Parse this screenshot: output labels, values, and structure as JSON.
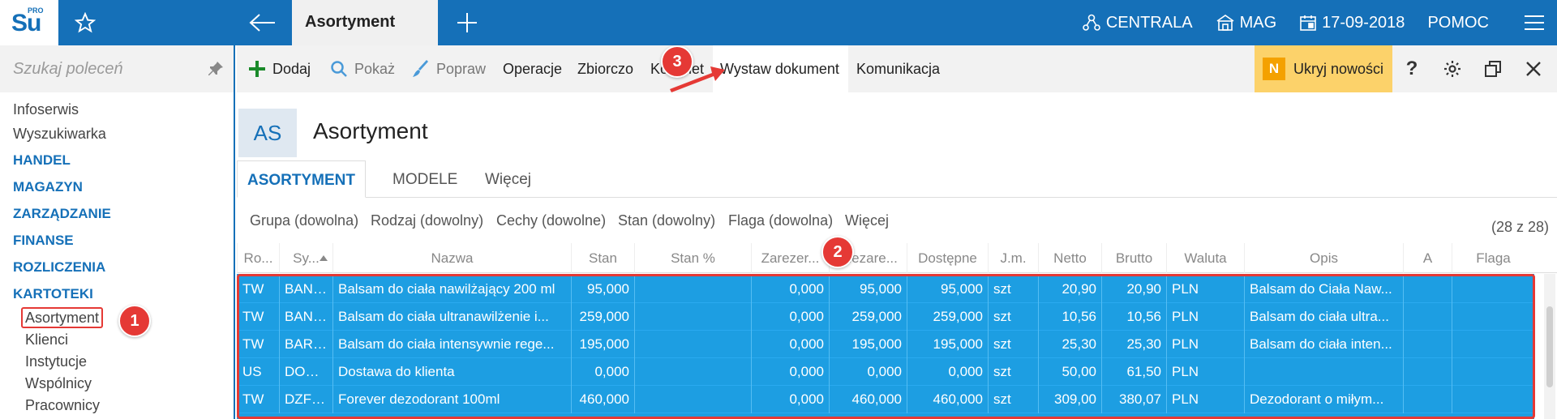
{
  "app": {
    "logo_text": "Su",
    "logo_pro": "PRO",
    "active_tab": "Asortyment"
  },
  "topbar": {
    "items": [
      "CENTRALA",
      "MAG",
      "17-09-2018",
      "POMOC"
    ]
  },
  "sidebar": {
    "search_placeholder": "Szukaj poleceń",
    "items": [
      "Infoserwis",
      "Wyszukiwarka"
    ],
    "sections": [
      "HANDEL",
      "MAGAZYN",
      "ZARZĄDZANIE",
      "FINANSE",
      "ROZLICZENIA",
      "KARTOTEKI"
    ],
    "sub_items": [
      "Asortyment",
      "Klienci",
      "Instytucje",
      "Wspólnicy",
      "Pracownicy"
    ]
  },
  "toolbar": {
    "add": "Dodaj",
    "show": "Pokaż",
    "edit": "Popraw",
    "operations": "Operacje",
    "bulk": "Zbiorczo",
    "kit": "Komplet",
    "issue_document": "Wystaw dokument",
    "communication": "Komunikacja",
    "hide_news": "Ukryj nowości",
    "news_badge": "N",
    "help": "?"
  },
  "module": {
    "badge": "AS",
    "title": "Asortyment"
  },
  "view_tabs": [
    "ASORTYMENT",
    "MODELE",
    "Więcej"
  ],
  "filters": {
    "items": [
      "Grupa (dowolna)",
      "Rodzaj (dowolny)",
      "Cechy (dowolne)",
      "Stan (dowolny)",
      "Flaga (dowolna)",
      "Więcej"
    ],
    "count": "(28 z 28)"
  },
  "grid": {
    "headers": [
      "Ro...",
      "Sy...",
      "Nazwa",
      "Stan",
      "Stan %",
      "Zarezer...",
      "Niezare...",
      "Dostępne",
      "J.m.",
      "Netto",
      "Brutto",
      "Waluta",
      "Opis",
      "A",
      "Flaga"
    ],
    "rows": [
      [
        "TW",
        "BANA...",
        "Balsam do ciała nawilżający 200 ml",
        "95,000",
        "",
        "0,000",
        "95,000",
        "95,000",
        "szt",
        "20,90",
        "20,90",
        "PLN",
        "Balsam do Ciała Naw...",
        "",
        ""
      ],
      [
        "TW",
        "BANA...",
        "Balsam do ciała ultranawilżenie i...",
        "259,000",
        "",
        "0,000",
        "259,000",
        "259,000",
        "szt",
        "10,56",
        "10,56",
        "PLN",
        "Balsam do ciała ultra...",
        "",
        ""
      ],
      [
        "TW",
        "BARE...",
        "Balsam do ciała intensywnie rege...",
        "195,000",
        "",
        "0,000",
        "195,000",
        "195,000",
        "szt",
        "25,30",
        "25,30",
        "PLN",
        "Balsam do ciała inten...",
        "",
        ""
      ],
      [
        "US",
        "DOST...",
        "Dostawa do klienta",
        "0,000",
        "",
        "0,000",
        "0,000",
        "0,000",
        "szt",
        "50,00",
        "61,50",
        "PLN",
        "",
        "",
        ""
      ],
      [
        "TW",
        "DZFO...",
        "Forever dezodorant 100ml",
        "460,000",
        "",
        "0,000",
        "460,000",
        "460,000",
        "szt",
        "309,00",
        "380,07",
        "PLN",
        "Dezodorant o miłym...",
        "",
        ""
      ]
    ]
  },
  "annotations": [
    "1",
    "2",
    "3"
  ],
  "colors": {
    "brand": "#1570b8",
    "selection": "#1d9ee2",
    "highlight": "#e53935",
    "news": "#fcd26a"
  }
}
